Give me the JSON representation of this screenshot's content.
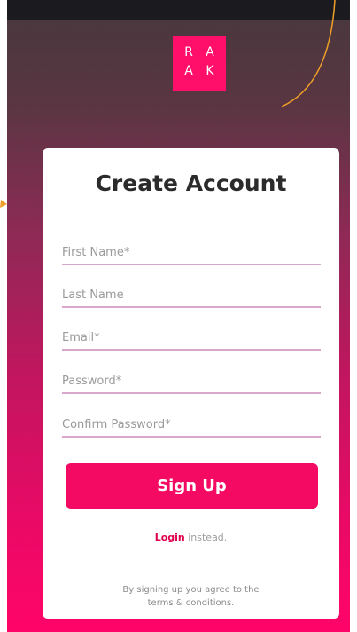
{
  "brand": {
    "logo_letters": [
      "R",
      "A",
      "A",
      "K"
    ],
    "accent_color": "#f40a63"
  },
  "form": {
    "title": "Create Account",
    "fields": {
      "first_name_placeholder": "First Name*",
      "last_name_placeholder": "Last Name",
      "email_placeholder": "Email*",
      "password_placeholder": "Password*",
      "confirm_password_placeholder": "Confirm Password*"
    },
    "signup_label": "Sign Up",
    "login_link": "Login",
    "login_suffix": " instead.",
    "terms_line1": "By signing up you agree to the",
    "terms_line2": "terms & conditions."
  }
}
